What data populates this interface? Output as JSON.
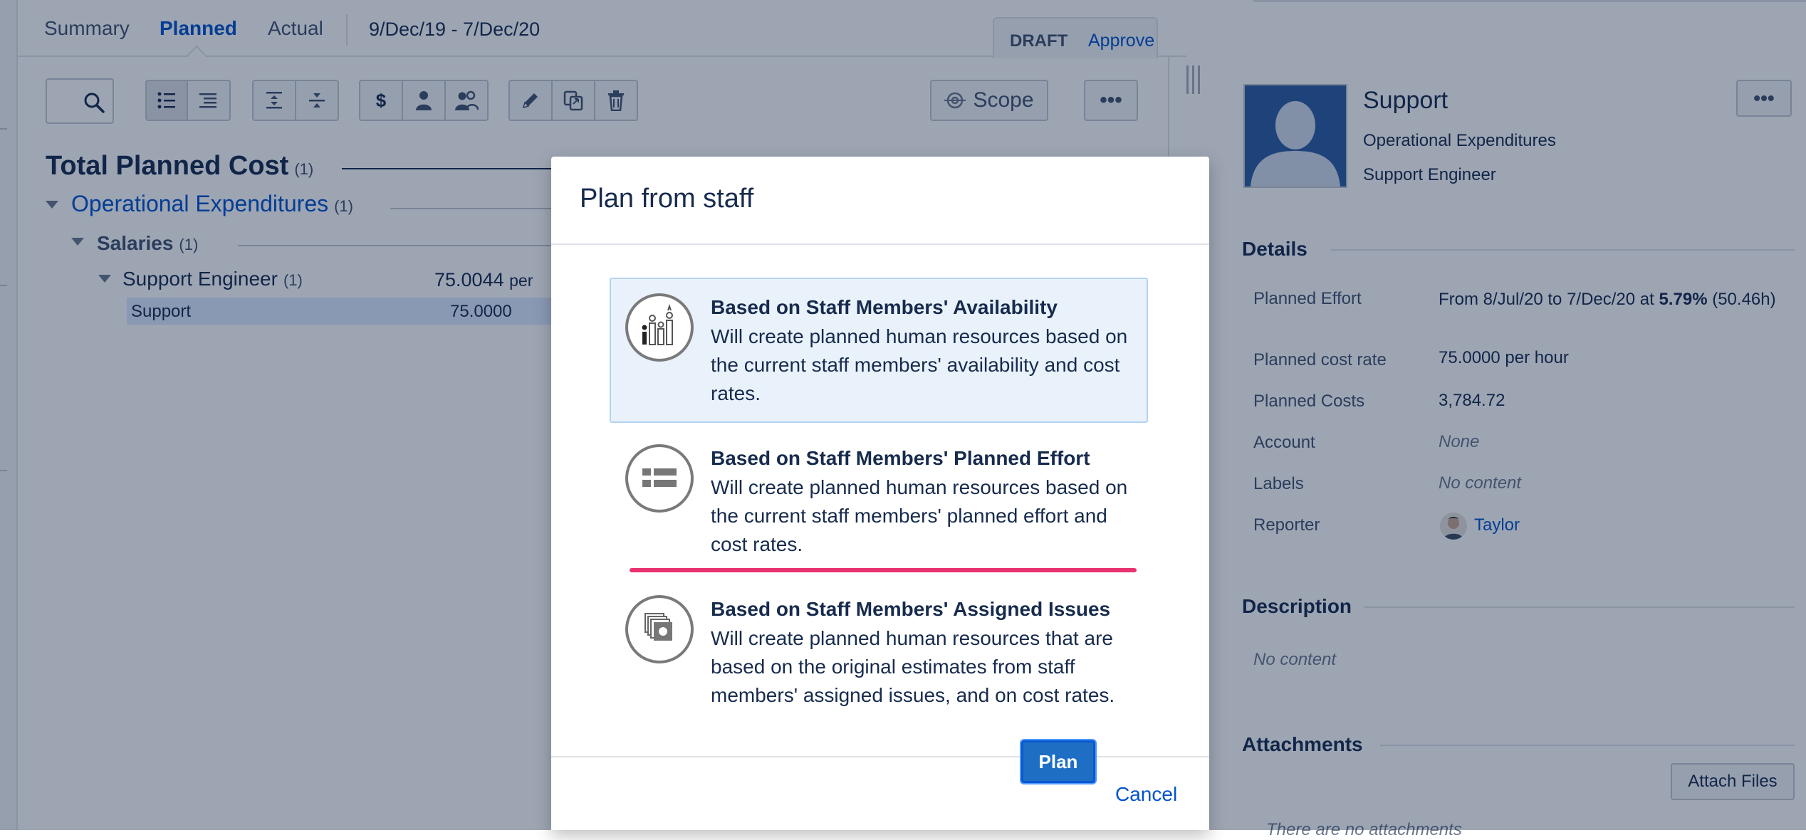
{
  "tabs": [
    {
      "label": "Summary"
    },
    {
      "label": "Planned"
    },
    {
      "label": "Actual"
    }
  ],
  "date_range": "9/Dec/19  - 7/Dec/20",
  "status": {
    "draft": "DRAFT",
    "approve": "Approve"
  },
  "toolbar": {
    "scope_label": "Scope",
    "more_label": "•••",
    "cost_label": "$"
  },
  "tree": {
    "total_title": "Total Planned Cost",
    "total_count": "(1)",
    "opex_label": "Operational Expenditures",
    "opex_count": "(1)",
    "salaries_label": "Salaries",
    "salaries_count": "(1)",
    "role_label": "Support Engineer",
    "role_count": "(1)",
    "role_value": "75.0044",
    "role_unit": "per",
    "row_label": "Support",
    "row_value": "75.0000"
  },
  "right_panel": {
    "name": "Support",
    "category": "Operational Expenditures",
    "role": "Support Engineer",
    "more_label": "•••",
    "details_title": "Details",
    "details": {
      "planned_effort_label": "Planned Effort",
      "planned_effort_value": "From 8/Jul/20 to 7/Dec/20 at",
      "planned_effort_pct": "5.79%",
      "planned_effort_hours": "(50.46h)",
      "cost_rate_label": "Planned cost rate",
      "cost_rate_value": "75.0000 per hour",
      "costs_label": "Planned Costs",
      "costs_value": "3,784.72",
      "account_label": "Account",
      "account_value": "None",
      "labels_label": "Labels",
      "labels_value": "No content",
      "reporter_label": "Reporter",
      "reporter_value": "Taylor"
    },
    "description_title": "Description",
    "description_value": "No content",
    "attachments_title": "Attachments",
    "attach_button": "Attach Files",
    "no_attachments": "There are no attachments"
  },
  "modal": {
    "title": "Plan from staff",
    "options": [
      {
        "title": "Based on Staff Members' Availability",
        "desc": "Will create planned human resources based on the current staff members' availability and cost rates.",
        "icon": "availability-icon",
        "selected": true
      },
      {
        "title": "Based on Staff Members' Planned Effort",
        "desc": "Will create planned human resources based on the current staff members' planned effort and cost rates.",
        "icon": "planned-effort-icon",
        "selected": false
      },
      {
        "title": "Based on Staff Members' Assigned Issues",
        "desc": "Will create planned human resources that are based on the original estimates from staff members' assigned issues, and on cost rates.",
        "icon": "assigned-issues-icon",
        "selected": false
      }
    ],
    "plan_button": "Plan",
    "cancel_link": "Cancel"
  },
  "colors": {
    "accent": "#0052cc",
    "plan_button": "#1e6fc4",
    "selected_option_bg": "#e9f2fb",
    "annotation_underline": "#e8336f"
  }
}
